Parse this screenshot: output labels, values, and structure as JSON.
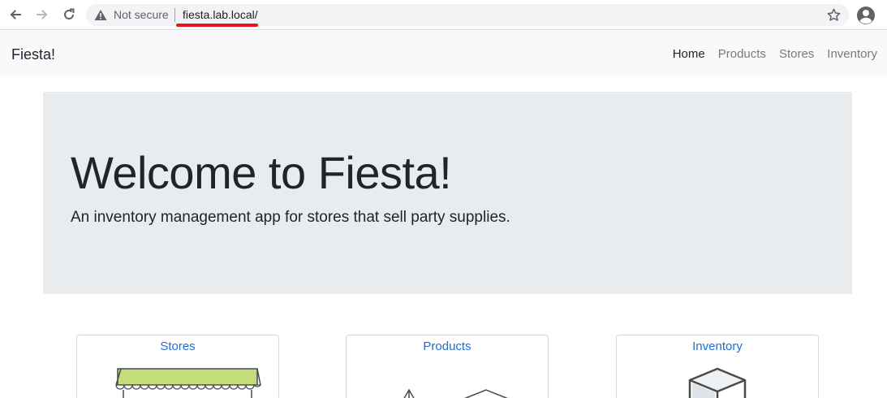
{
  "browser": {
    "security_label": "Not secure",
    "url": "fiesta.lab.local/",
    "accent_underline_color": "#e8141c"
  },
  "navbar": {
    "brand": "Fiesta!",
    "links": [
      {
        "label": "Home",
        "active": true
      },
      {
        "label": "Products",
        "active": false
      },
      {
        "label": "Stores",
        "active": false
      },
      {
        "label": "Inventory",
        "active": false
      }
    ]
  },
  "jumbotron": {
    "title": "Welcome to Fiesta!",
    "lead": "An inventory management app for stores that sell party supplies."
  },
  "cards": [
    {
      "title": "Stores",
      "icon": "store-awning-icon"
    },
    {
      "title": "Products",
      "icon": "party-supplies-icon"
    },
    {
      "title": "Inventory",
      "icon": "box-icon"
    }
  ],
  "colors": {
    "link": "#1b6fd8",
    "jumbotron_bg": "#e9ecef",
    "navbar_bg": "#f8f9fa",
    "awning_green": "#c5dc7a"
  }
}
